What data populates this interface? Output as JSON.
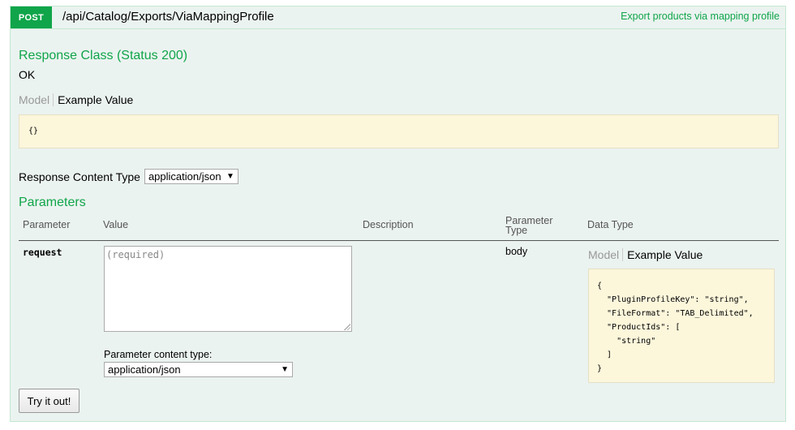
{
  "operation": {
    "method": "POST",
    "path": "/api/Catalog/Exports/ViaMappingProfile",
    "summary": "Export products via mapping profile"
  },
  "response_class": {
    "title": "Response Class (Status 200)",
    "status_text": "OK",
    "tabs": {
      "model": "Model",
      "example": "Example Value"
    },
    "example_value": "{}"
  },
  "response_content_type": {
    "label": "Response Content Type",
    "selected": "application/json"
  },
  "parameters": {
    "title": "Parameters",
    "headers": {
      "parameter": "Parameter",
      "value": "Value",
      "description": "Description",
      "parameter_type_line1": "Parameter",
      "parameter_type_line2": "Type",
      "data_type": "Data Type"
    },
    "rows": [
      {
        "name": "request",
        "placeholder": "(required)",
        "content_type_label": "Parameter content type:",
        "content_type_selected": "application/json",
        "description": "",
        "param_type": "body",
        "data_type_tabs": {
          "model": "Model",
          "example": "Example Value"
        },
        "example_json": "{\n  \"PluginProfileKey\": \"string\",\n  \"FileFormat\": \"TAB_Delimited\",\n  \"ProductIds\": [\n    \"string\"\n  ]\n}"
      }
    ]
  },
  "actions": {
    "try_it_out": "Try it out!"
  },
  "colors": {
    "post_green": "#10a54a",
    "panel_bg": "#ebf3f0",
    "panel_border": "#c3e8d1",
    "code_bg": "#fcf6db"
  }
}
